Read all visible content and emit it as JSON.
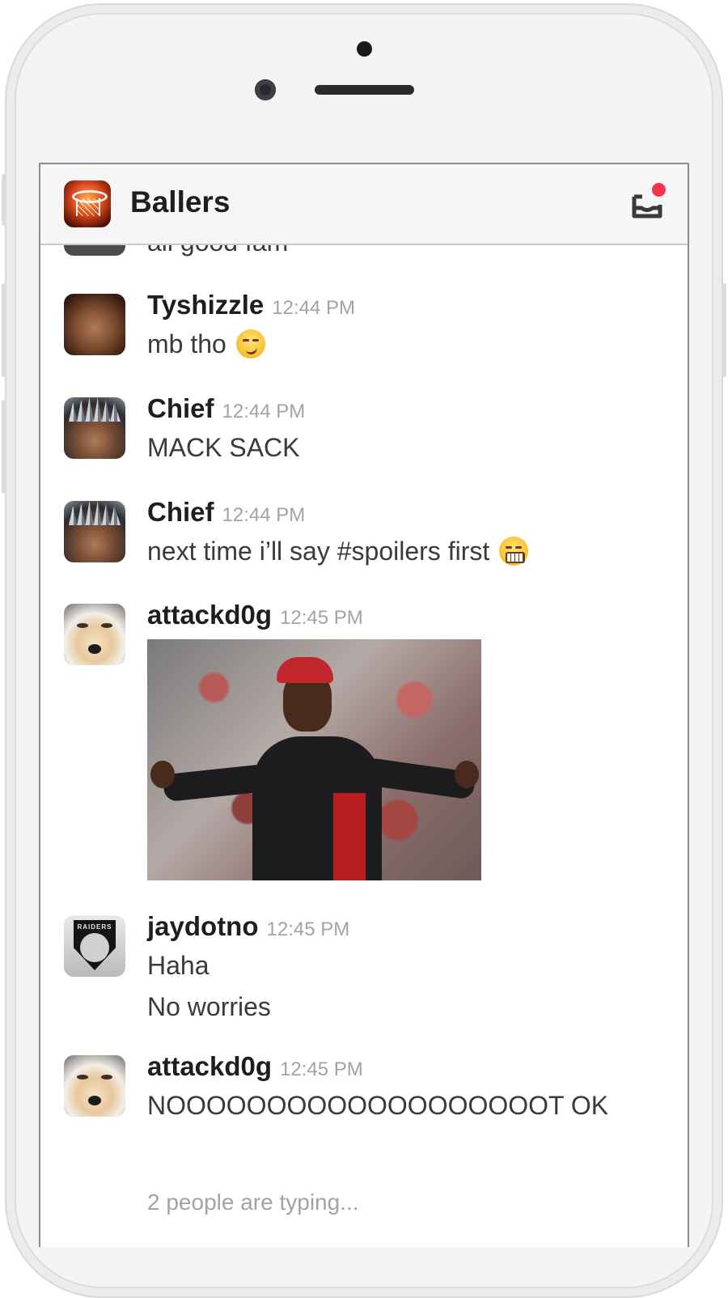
{
  "header": {
    "channel_name": "Ballers",
    "notification_color": "#f2354d"
  },
  "partial_message": {
    "text": "all good fam"
  },
  "messages": [
    {
      "user": "Tyshizzle",
      "time": "12:44 PM",
      "lines": [
        "mb tho"
      ],
      "emoji": "smirk-emoji"
    },
    {
      "user": "Chief",
      "time": "12:44 PM",
      "lines": [
        "MACK SACK"
      ]
    },
    {
      "user": "Chief",
      "time": "12:44 PM",
      "lines": [
        "next time i’ll say #spoilers first"
      ],
      "emoji": "grimace-emoji"
    },
    {
      "user": "attackd0g",
      "time": "12:45 PM",
      "lines": [],
      "attachment": "photo"
    },
    {
      "user": "jaydotno",
      "time": "12:45 PM",
      "lines": [
        "Haha",
        "No worries"
      ],
      "avatar_text": "RAIDERS"
    },
    {
      "user": "attackd0g",
      "time": "12:45 PM",
      "lines": [
        "NOOOOOOOOOOOOOOOOOOOT OK"
      ]
    }
  ],
  "typing_indicator": "2 people are typing..."
}
